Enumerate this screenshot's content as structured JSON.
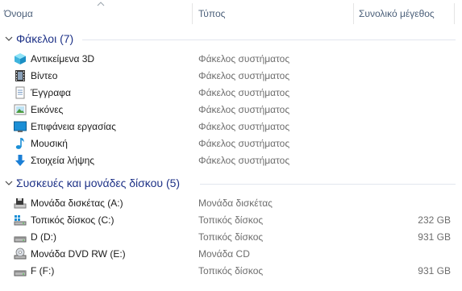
{
  "columns": {
    "name": "Όνομα",
    "type": "Τύπος",
    "size": "Συνολικό μέγεθος"
  },
  "groups": {
    "folders": {
      "title": "Φάκελοι (7)",
      "items": [
        {
          "name": "Αντικείμενα 3D",
          "type": "Φάκελος συστήματος",
          "icon": "3d-objects-icon"
        },
        {
          "name": "Βίντεο",
          "type": "Φάκελος συστήματος",
          "icon": "video-icon"
        },
        {
          "name": "Έγγραφα",
          "type": "Φάκελος συστήματος",
          "icon": "documents-icon"
        },
        {
          "name": "Εικόνες",
          "type": "Φάκελος συστήματος",
          "icon": "pictures-icon"
        },
        {
          "name": "Επιφάνεια εργασίας",
          "type": "Φάκελος συστήματος",
          "icon": "desktop-icon"
        },
        {
          "name": "Μουσική",
          "type": "Φάκελος συστήματος",
          "icon": "music-icon"
        },
        {
          "name": "Στοιχεία λήψης",
          "type": "Φάκελος συστήματος",
          "icon": "downloads-icon"
        }
      ]
    },
    "drives": {
      "title": "Συσκευές και μονάδες δίσκου (5)",
      "items": [
        {
          "name": "Μονάδα δισκέτας (A:)",
          "type": "Μονάδα δισκέτας",
          "size": "",
          "icon": "floppy-drive-icon"
        },
        {
          "name": "Τοπικός δίσκος (C:)",
          "type": "Τοπικός δίσκος",
          "size": "232 GB",
          "icon": "system-drive-icon"
        },
        {
          "name": "D (D:)",
          "type": "Τοπικός δίσκος",
          "size": "931 GB",
          "icon": "hard-drive-icon"
        },
        {
          "name": "Μονάδα DVD RW (E:)",
          "type": "Μονάδα CD",
          "size": "",
          "icon": "dvd-drive-icon"
        },
        {
          "name": "F (F:)",
          "type": "Τοπικός δίσκος",
          "size": "931 GB",
          "icon": "hard-drive-icon"
        }
      ]
    }
  },
  "colors": {
    "group_title": "#1e3287",
    "header_text": "#4c607a",
    "secondary_text": "#6d6d6d"
  }
}
